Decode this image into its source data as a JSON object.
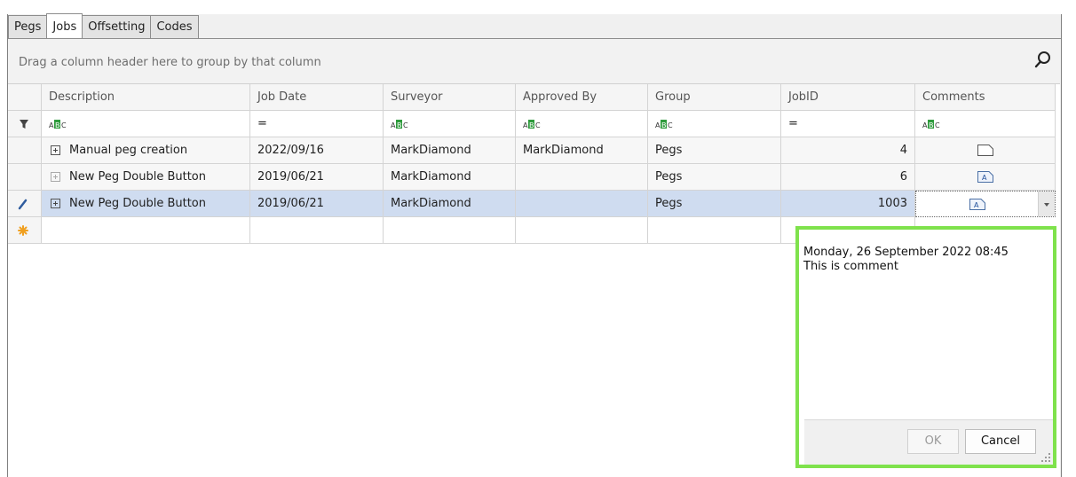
{
  "tabs": [
    {
      "label": "Pegs",
      "active": false
    },
    {
      "label": "Jobs",
      "active": true
    },
    {
      "label": "Offsetting",
      "active": false
    },
    {
      "label": "Codes",
      "active": false
    }
  ],
  "group_panel": {
    "hint": "Drag a column header here to group by that column"
  },
  "columns": [
    "Description",
    "Job Date",
    "Surveyor",
    "Approved By",
    "Group",
    "JobID",
    "Comments"
  ],
  "filter_row": {
    "equals_symbol": "="
  },
  "rows": [
    {
      "description": "Manual peg creation",
      "job_date": "2022/09/16",
      "surveyor": "MarkDiamond",
      "approved_by": "MarkDiamond",
      "group": "Pegs",
      "job_id": "4",
      "comment_icon": "empty-memo-icon"
    },
    {
      "description": "New Peg Double Button",
      "job_date": "2019/06/21",
      "surveyor": "MarkDiamond",
      "approved_by": "",
      "group": "Pegs",
      "job_id": "6",
      "comment_icon": "text-memo-icon"
    },
    {
      "description": "New Peg Double Button",
      "job_date": "2019/06/21",
      "surveyor": "MarkDiamond",
      "approved_by": "",
      "group": "Pegs",
      "job_id": "1003",
      "comment_icon": "text-memo-icon"
    }
  ],
  "memo_popup": {
    "text": "Monday, 26 September 2022 08:45\nThis is comment",
    "ok_label": "OK",
    "cancel_label": "Cancel"
  },
  "colors": {
    "selection": "#cfdcf0",
    "highlight_border": "#7fe24c",
    "abc_green": "#2e9b3c"
  }
}
